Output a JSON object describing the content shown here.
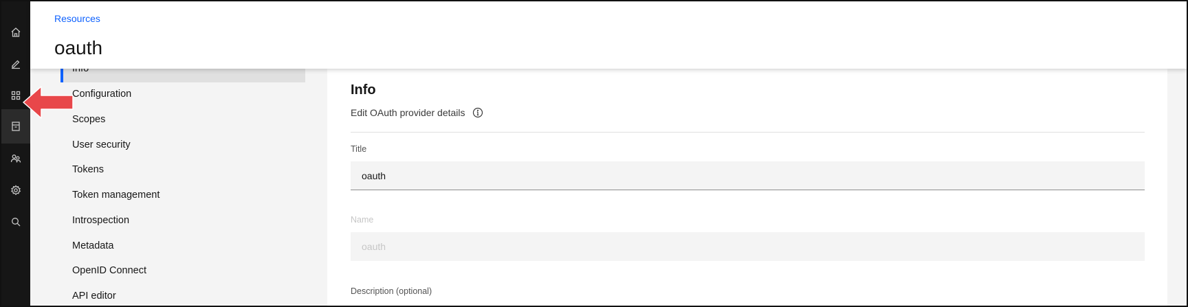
{
  "header": {
    "breadcrumb": "Resources",
    "title": "oauth"
  },
  "rail": {
    "items": [
      {
        "icon": "home-icon"
      },
      {
        "icon": "edit-icon"
      },
      {
        "icon": "apps-grid-icon"
      },
      {
        "icon": "data-store-icon",
        "active": true
      },
      {
        "icon": "users-icon"
      },
      {
        "icon": "settings-icon"
      },
      {
        "icon": "search-icon"
      }
    ]
  },
  "subnav": {
    "active": "Info",
    "items": [
      "Info",
      "Configuration",
      "Scopes",
      "User security",
      "Tokens",
      "Token management",
      "Introspection",
      "Metadata",
      "OpenID Connect",
      "API editor"
    ]
  },
  "panel": {
    "title": "Info",
    "subtitle": "Edit OAuth provider details",
    "fields": {
      "title": {
        "label": "Title",
        "value": "oauth"
      },
      "name": {
        "label": "Name",
        "value": "oauth"
      },
      "description": {
        "label": "Description (optional)"
      }
    }
  },
  "annotation": {
    "arrow_color": "#e8474a"
  },
  "colors": {
    "accent": "#0f62fe",
    "rail_bg": "#161616",
    "nav_bg": "#f4f4f4"
  }
}
